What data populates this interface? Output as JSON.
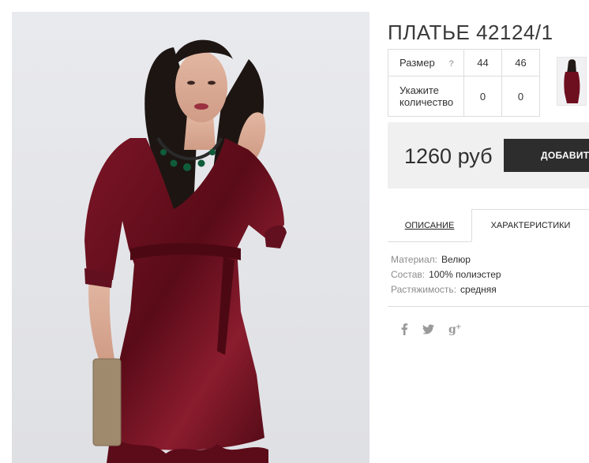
{
  "product": {
    "title": "ПЛАТЬЕ 42124/1"
  },
  "size_table": {
    "size_label": "Размер",
    "help_icon": "?",
    "sizes": [
      "44",
      "46"
    ],
    "quantity_label": "Укажите количество",
    "quantities": [
      "0",
      "0"
    ]
  },
  "price_block": {
    "price": "1260 руб",
    "buy_label": "ДОБАВИТЬ В КОРЗИНУ",
    "buy_icon": "shopping-bag-icon"
  },
  "tabs": [
    {
      "label": "ОПИСАНИЕ",
      "active": false
    },
    {
      "label": "ХАРАКТЕРИСТИКИ",
      "active": true
    }
  ],
  "specs": [
    {
      "label": "Материал:",
      "value": "Велюр"
    },
    {
      "label": "Состав:",
      "value": "100% полиэстер"
    },
    {
      "label": "Растяжимость:",
      "value": "средняя"
    }
  ],
  "social": [
    {
      "name": "facebook-icon",
      "glyph": "f"
    },
    {
      "name": "twitter-icon",
      "glyph": "🐦"
    },
    {
      "name": "google-plus-icon",
      "glyph": "g⁺"
    }
  ],
  "colors": {
    "dress": "#6e0f1f",
    "button": "#2d2d2d",
    "price_bg": "#f0f0f0"
  }
}
